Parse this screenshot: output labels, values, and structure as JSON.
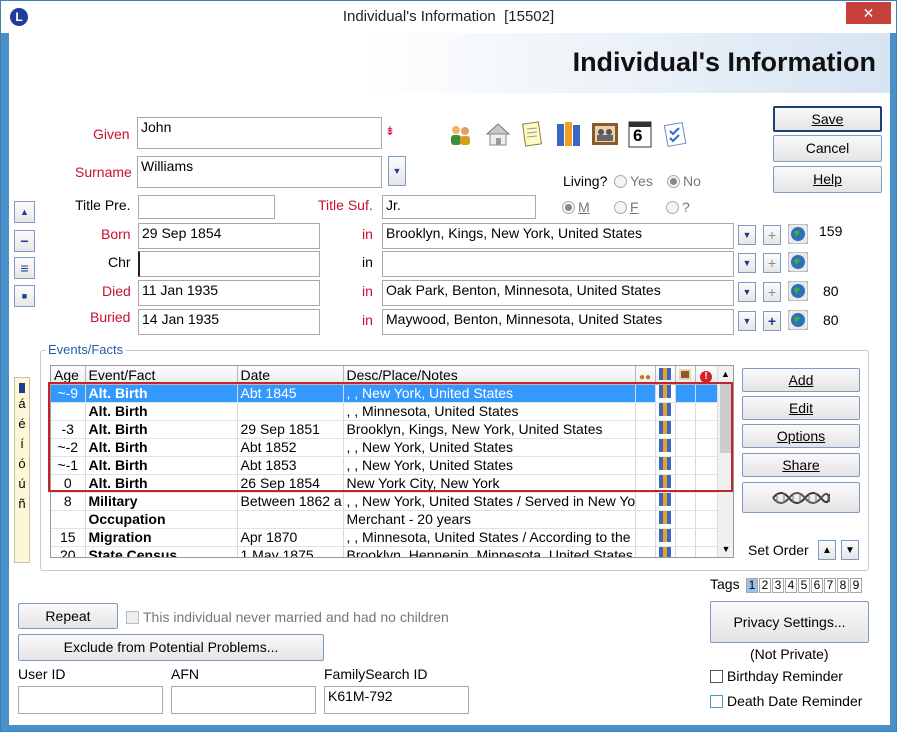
{
  "window": {
    "title": "Individual's Information  [15502]",
    "app_icon": "L",
    "close_label": "✕"
  },
  "header": {
    "title": "Individual's Information"
  },
  "name": {
    "given_label": "Given",
    "given_value": "John",
    "surname_label": "Surname",
    "surname_value": "Williams",
    "title_pre_label": "Title Pre.",
    "title_pre_value": "",
    "title_suf_label": "Title Suf.",
    "title_suf_value": "Jr."
  },
  "toolbar_icons": [
    "family-icon",
    "home-icon",
    "notepad-icon",
    "books-icon",
    "photo-icon",
    "calendar-icon",
    "checklist-icon"
  ],
  "calendar_day": "6",
  "buttons": {
    "save": "Save",
    "cancel": "Cancel",
    "help": "Help"
  },
  "living": {
    "label": "Living?",
    "yes": "Yes",
    "no": "No"
  },
  "sex": {
    "m": "M",
    "f": "F",
    "unknown": "?"
  },
  "vitals": [
    {
      "label": "Born",
      "date": "29 Sep 1854",
      "in": "in",
      "place": "Brooklyn, Kings, New York, United States",
      "count": "159"
    },
    {
      "label": "Chr",
      "date": "",
      "in": "in",
      "place": "",
      "count": ""
    },
    {
      "label": "Died",
      "date": "11 Jan 1935",
      "in": "in",
      "place": "Oak Park, Benton, Minnesota, United States",
      "count": "80"
    },
    {
      "label": "Buried",
      "date": "14 Jan 1935",
      "in": "in",
      "place": "Maywood, Benton, Minnesota, United States",
      "count": "80"
    }
  ],
  "events": {
    "group_label": "Events/Facts",
    "columns": [
      "Age",
      "Event/Fact",
      "Date",
      "Desc/Place/Notes"
    ],
    "rows": [
      {
        "age": "~-9",
        "event": "Alt. Birth",
        "date": "Abt 1845",
        "desc": ", , New York, United States"
      },
      {
        "age": "",
        "event": "Alt. Birth",
        "date": "",
        "desc": ", , Minnesota, United States"
      },
      {
        "age": "-3",
        "event": "Alt. Birth",
        "date": "29 Sep 1851",
        "desc": "Brooklyn, Kings, New York, United States"
      },
      {
        "age": "~-2",
        "event": "Alt. Birth",
        "date": "Abt 1852",
        "desc": ", , New York, United States"
      },
      {
        "age": "~-1",
        "event": "Alt. Birth",
        "date": "Abt 1853",
        "desc": ", , New York, United States"
      },
      {
        "age": "0",
        "event": "Alt. Birth",
        "date": "26 Sep 1854",
        "desc": "New York City, New York"
      },
      {
        "age": "8",
        "event": "Military",
        "date": "Between 1862 a",
        "desc": ", , New York, United States / Served in New Yo"
      },
      {
        "age": "",
        "event": "Occupation",
        "date": "",
        "desc": "Merchant - 20 years"
      },
      {
        "age": "15",
        "event": "Migration",
        "date": "Apr 1870",
        "desc": ", , Minnesota, United States / According to the"
      },
      {
        "age": "20",
        "event": "State Census",
        "date": "1 May 1875",
        "desc": "Brooklyn, Hennepin, Minnesota, United States"
      }
    ],
    "side_buttons": {
      "add": "Add",
      "edit": "Edit",
      "options": "Options",
      "share": "Share"
    },
    "set_order": "Set Order"
  },
  "accent_chars": [
    "á",
    "é",
    "í",
    "ó",
    "ú",
    "ñ"
  ],
  "tags": {
    "label": "Tags",
    "numbers": [
      "1",
      "2",
      "3",
      "4",
      "5",
      "6",
      "7",
      "8",
      "9"
    ]
  },
  "bottom": {
    "repeat": "Repeat",
    "never_married": "This individual never married and had no children",
    "exclude": "Exclude from Potential Problems...",
    "privacy": "Privacy Settings...",
    "privacy_status": "(Not Private)",
    "birthday_reminder": "Birthday Reminder",
    "death_reminder": "Death Date Reminder",
    "user_id_label": "User ID",
    "user_id_value": "",
    "afn_label": "AFN",
    "afn_value": "",
    "fs_label": "FamilySearch ID",
    "fs_value": "K61M-792"
  },
  "colors": {
    "selection": "#3399ff",
    "required_label": "#c8102e",
    "highlight_border": "#c0272d",
    "window_frame": "#4a90c8"
  }
}
